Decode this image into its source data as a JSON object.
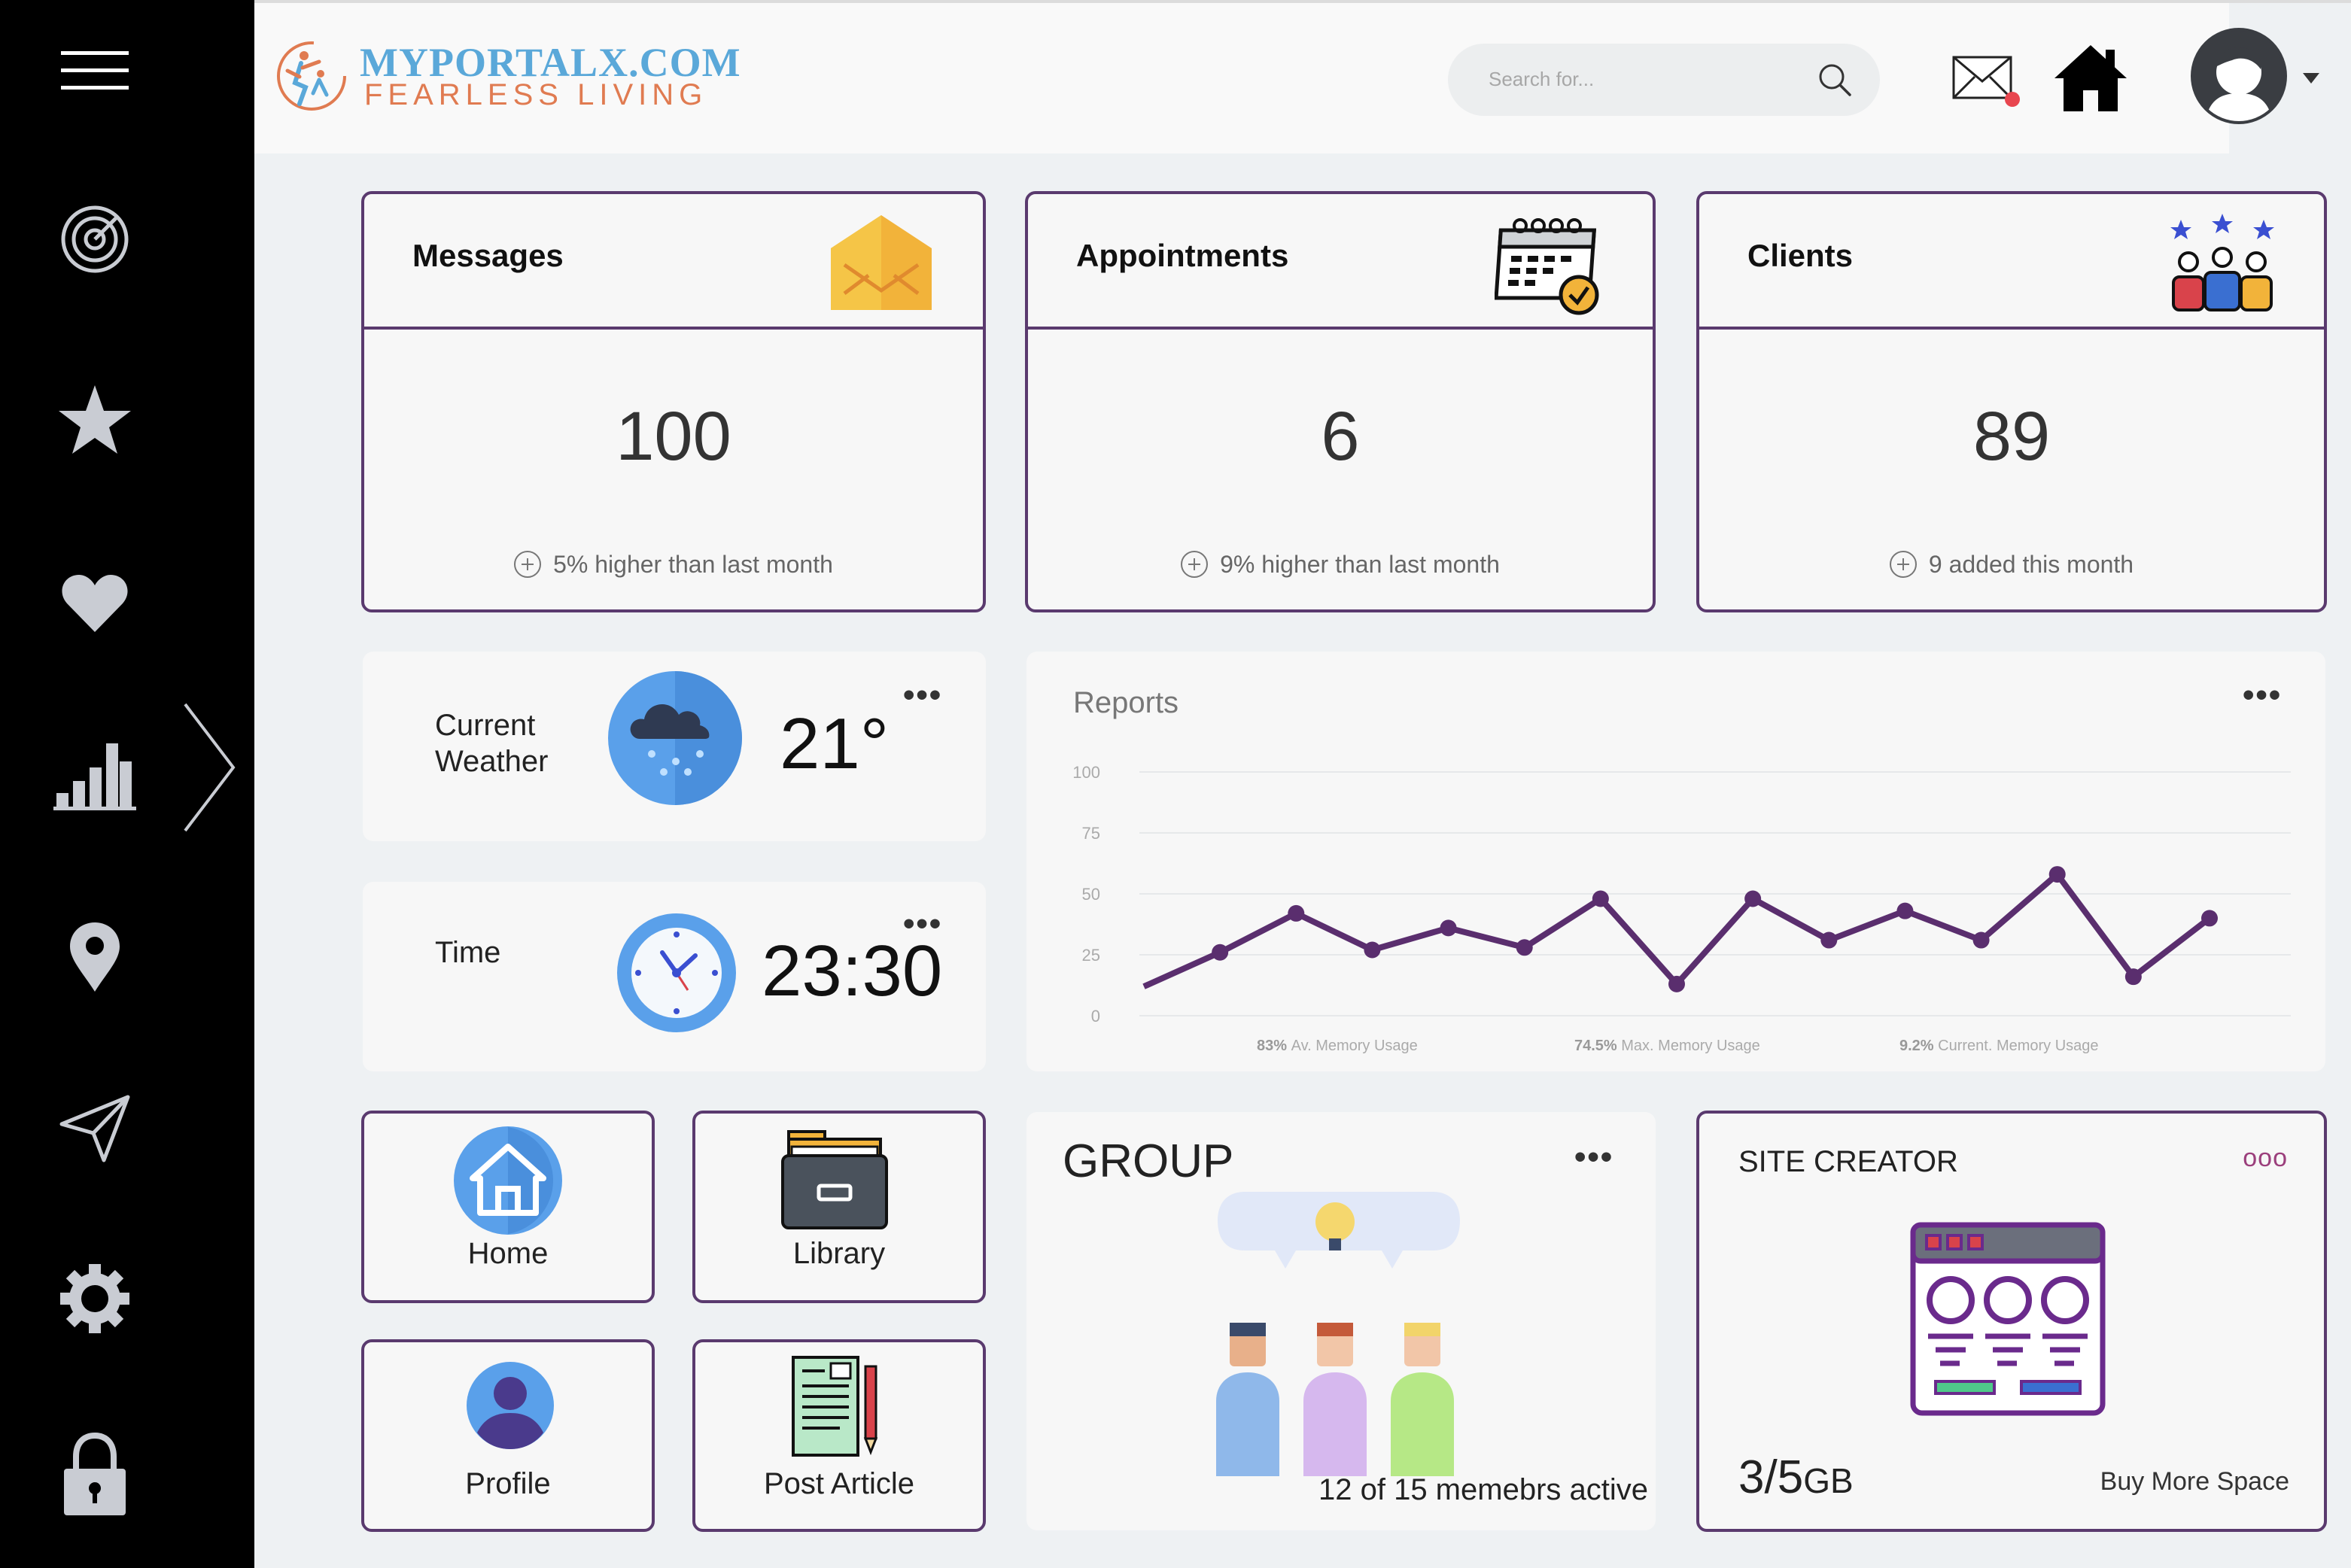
{
  "header": {
    "brand_title": "MYPORTALX.COM",
    "brand_subtitle": "FEARLESS LIVING",
    "search_placeholder": "Search for...",
    "icons": [
      "search-icon",
      "mail-icon",
      "home-icon",
      "avatar",
      "caret-down-icon"
    ],
    "notification_color": "#e8464f"
  },
  "sidebar": {
    "items": [
      {
        "icon": "menu-icon"
      },
      {
        "icon": "target-icon"
      },
      {
        "icon": "star-icon"
      },
      {
        "icon": "heart-icon"
      },
      {
        "icon": "bar-chart-icon",
        "active": true
      },
      {
        "icon": "location-pin-icon"
      },
      {
        "icon": "send-icon"
      },
      {
        "icon": "gear-icon"
      },
      {
        "icon": "lock-icon"
      }
    ]
  },
  "stats": {
    "messages": {
      "title": "Messages",
      "value": "100",
      "note": "5% higher than last month"
    },
    "appointments": {
      "title": "Appointments",
      "value": "6",
      "note": "9% higher than last month"
    },
    "clients": {
      "title": "Clients",
      "value": "89",
      "note": "9 added this month"
    }
  },
  "weather": {
    "label_line1": "Current",
    "label_line2": "Weather",
    "value": "21°",
    "menu": "•••"
  },
  "time": {
    "label": "Time",
    "value": "23:30",
    "menu": "•••"
  },
  "tiles": {
    "home": "Home",
    "library": "Library",
    "profile": "Profile",
    "post_article": "Post Article"
  },
  "reports": {
    "title": "Reports",
    "menu": "•••",
    "footnotes": [
      {
        "pct": "83%",
        "text": "Av. Memory Usage"
      },
      {
        "pct": "74.5%",
        "text": "Max. Memory Usage"
      },
      {
        "pct": "9.2%",
        "text": "Current. Memory Usage"
      }
    ]
  },
  "chart_data": {
    "type": "line",
    "title": "Reports",
    "ylim": [
      0,
      100
    ],
    "yticks": [
      0,
      25,
      50,
      75,
      100
    ],
    "grid": true,
    "series": [
      {
        "values": [
          12,
          26,
          42,
          27,
          36,
          28,
          48,
          13,
          48,
          31,
          43,
          31,
          58,
          16,
          40
        ]
      }
    ],
    "color": "#5a2e6e"
  },
  "group": {
    "title": "GROUP",
    "menu": "•••",
    "note": "12 of 15 memebrs active"
  },
  "site_creator": {
    "title": "SITE CREATOR",
    "menu": "ooo",
    "storage_main": "3/5",
    "storage_unit": "GB",
    "buy_more": "Buy More Space"
  }
}
